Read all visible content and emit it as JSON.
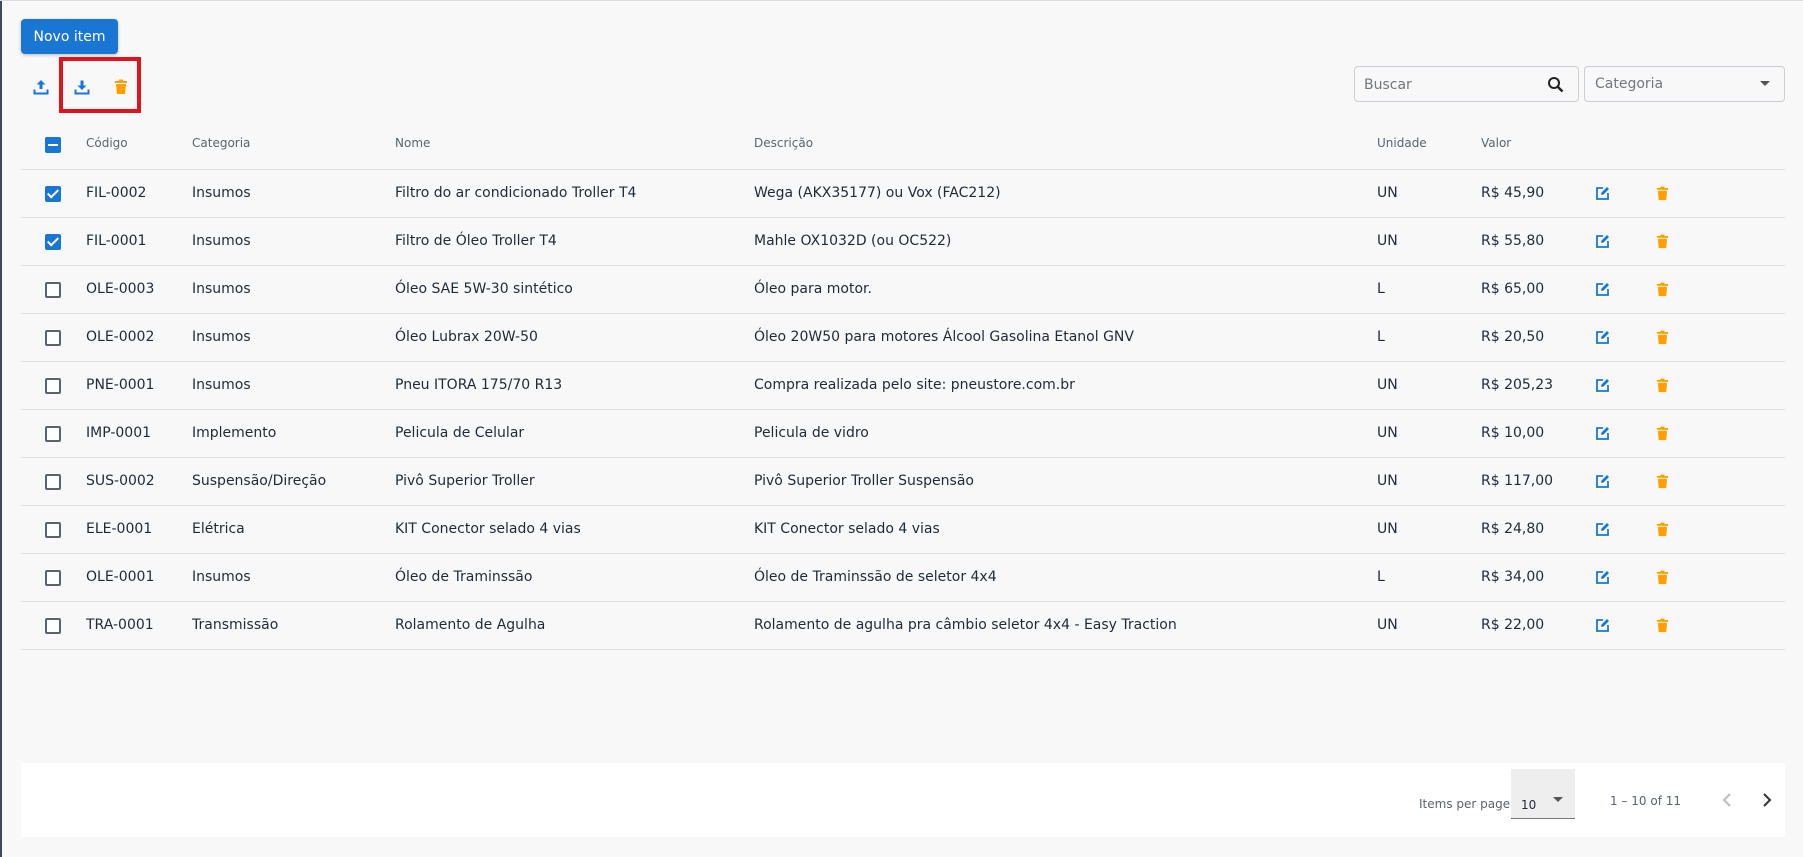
{
  "toolbar": {
    "new_item_label": "Novo item",
    "search_placeholder": "Buscar",
    "category_placeholder": "Categoria"
  },
  "colors": {
    "primary": "#1976d2",
    "warn": "#ffa000",
    "highlight": "#e0121c"
  },
  "icons": {
    "upload": "upload-icon",
    "download": "download-icon",
    "delete": "trash-icon",
    "search": "search-icon",
    "edit": "edit-icon"
  },
  "table": {
    "headers": {
      "code": "Código",
      "category": "Categoria",
      "name": "Nome",
      "description": "Descrição",
      "unit": "Unidade",
      "value": "Valor"
    },
    "rows": [
      {
        "checked": true,
        "code": "FIL-0002",
        "category": "Insumos",
        "name": "Filtro do ar condicionado Troller T4",
        "description": "Wega (AKX35177) ou Vox (FAC212)",
        "unit": "UN",
        "value": "R$ 45,90"
      },
      {
        "checked": true,
        "code": "FIL-0001",
        "category": "Insumos",
        "name": "Filtro de Óleo Troller T4",
        "description": "Mahle OX1032D (ou OC522)",
        "unit": "UN",
        "value": "R$ 55,80"
      },
      {
        "checked": false,
        "code": "OLE-0003",
        "category": "Insumos",
        "name": "Óleo SAE 5W-30 sintético",
        "description": "Óleo para motor.",
        "unit": "L",
        "value": "R$ 65,00"
      },
      {
        "checked": false,
        "code": "OLE-0002",
        "category": "Insumos",
        "name": "Óleo Lubrax 20W-50",
        "description": "Óleo 20W50 para motores Álcool Gasolina Etanol GNV",
        "unit": "L",
        "value": "R$ 20,50"
      },
      {
        "checked": false,
        "code": "PNE-0001",
        "category": "Insumos",
        "name": "Pneu ITORA 175/70 R13",
        "description": "Compra realizada pelo site: pneustore.com.br",
        "unit": "UN",
        "value": "R$ 205,23"
      },
      {
        "checked": false,
        "code": "IMP-0001",
        "category": "Implemento",
        "name": "Pelicula de Celular",
        "description": "Pelicula de vidro",
        "unit": "UN",
        "value": "R$ 10,00"
      },
      {
        "checked": false,
        "code": "SUS-0002",
        "category": "Suspensão/Direção",
        "name": "Pivô Superior Troller",
        "description": "Pivô Superior Troller Suspensão",
        "unit": "UN",
        "value": "R$ 117,00"
      },
      {
        "checked": false,
        "code": "ELE-0001",
        "category": "Elétrica",
        "name": "KIT Conector selado 4 vias",
        "description": "KIT Conector selado 4 vias",
        "unit": "UN",
        "value": "R$ 24,80"
      },
      {
        "checked": false,
        "code": "OLE-0001",
        "category": "Insumos",
        "name": "Óleo de Traminssão",
        "description": "Óleo de Traminssão de seletor 4x4",
        "unit": "L",
        "value": "R$ 34,00"
      },
      {
        "checked": false,
        "code": "TRA-0001",
        "category": "Transmissão",
        "name": "Rolamento de Agulha",
        "description": "Rolamento de agulha pra câmbio seletor 4x4 - Easy Traction",
        "unit": "UN",
        "value": "R$ 22,00"
      }
    ]
  },
  "paginator": {
    "items_per_page_label": "Items per page:",
    "items_per_page_value": "10",
    "range_label": "1 – 10 of 11"
  }
}
